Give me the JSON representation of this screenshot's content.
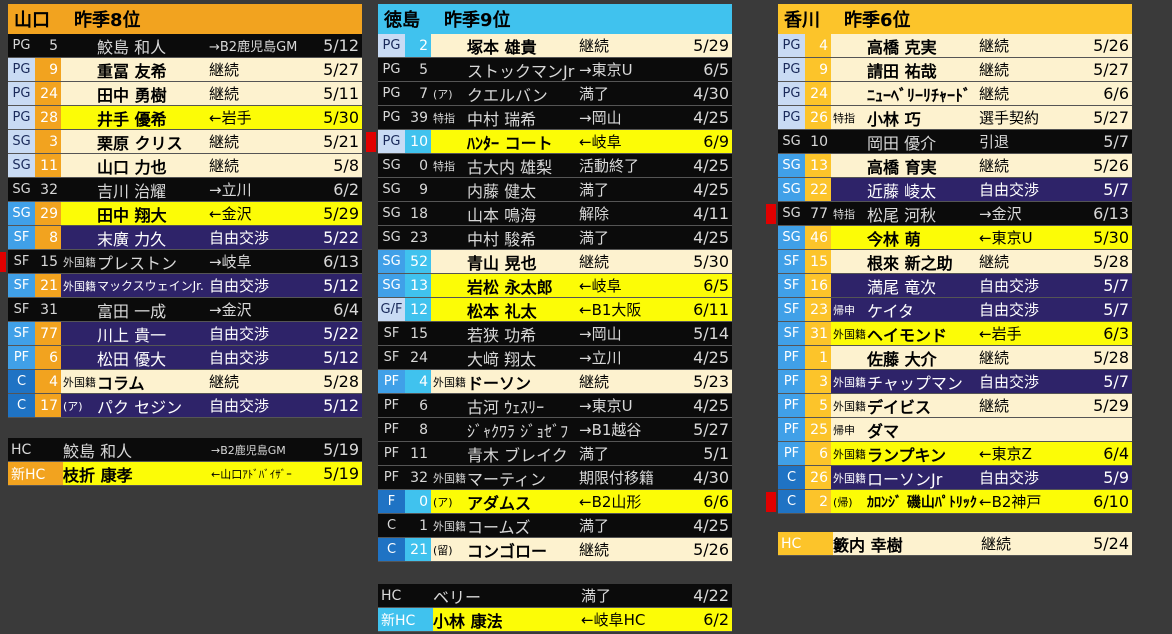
{
  "colors": {
    "black": "#0b0b0b",
    "cream": "#fdf2cf",
    "yellow": "#fcfc06",
    "navy": "#2e2369",
    "orange": "#f2a31f",
    "cyan": "#40c2ee",
    "gold": "#fcc42a",
    "lightblue": "#c9dbf4",
    "blue": "#1f73c4",
    "red": "#e00000",
    "gray": "#555555"
  },
  "panels": [
    {
      "team": "山口",
      "prev": "昨季8位",
      "header_color": "#f2a31f",
      "players": [
        {
          "pos": "PG",
          "num": "5",
          "tag": "",
          "name": "鮫島 和人",
          "status": "→B2鹿児島GM",
          "date": "5/12",
          "theme": "black",
          "pos_color": "#0b0b0b",
          "num_color": "#0b0b0b",
          "mark": false
        },
        {
          "pos": "PG",
          "num": "9",
          "tag": "",
          "name": "重冨 友希",
          "status": "継続",
          "date": "5/27",
          "theme": "cream",
          "pos_color": "#c9dbf4",
          "num_color": "#f2a31f",
          "mark": false
        },
        {
          "pos": "PG",
          "num": "24",
          "tag": "",
          "name": "田中 勇樹",
          "status": "継続",
          "date": "5/11",
          "theme": "cream",
          "pos_color": "#c9dbf4",
          "num_color": "#f2a31f",
          "mark": false
        },
        {
          "pos": "PG",
          "num": "28",
          "tag": "",
          "name": "井手 優希",
          "status": "←岩手",
          "date": "5/30",
          "theme": "yellow",
          "pos_color": "#c9dbf4",
          "num_color": "#f2a31f",
          "mark": false
        },
        {
          "pos": "SG",
          "num": "3",
          "tag": "",
          "name": "栗原 クリス",
          "status": "継続",
          "date": "5/21",
          "theme": "cream",
          "pos_color": "#c9dbf4",
          "num_color": "#f2a31f",
          "mark": false
        },
        {
          "pos": "SG",
          "num": "11",
          "tag": "",
          "name": "山口 力也",
          "status": "継続",
          "date": "5/8",
          "theme": "cream",
          "pos_color": "#c9dbf4",
          "num_color": "#f2a31f",
          "mark": false
        },
        {
          "pos": "SG",
          "num": "32",
          "tag": "",
          "name": "吉川 治耀",
          "status": "→立川",
          "date": "6/2",
          "theme": "black",
          "pos_color": "#0b0b0b",
          "num_color": "#0b0b0b",
          "mark": false
        },
        {
          "pos": "SG",
          "num": "29",
          "tag": "",
          "name": "田中 翔大",
          "status": "←金沢",
          "date": "5/29",
          "theme": "yellow",
          "pos_color": "#40a0e8",
          "num_color": "#f2a31f",
          "mark": false
        },
        {
          "pos": "SF",
          "num": "8",
          "tag": "",
          "name": "末廣 力久",
          "status": "自由交渉",
          "date": "5/22",
          "theme": "navy",
          "pos_color": "#40a0e8",
          "num_color": "#f2a31f",
          "mark": false
        },
        {
          "pos": "SF",
          "num": "15",
          "tag": "外国籍",
          "name": "プレストン",
          "status": "→岐阜",
          "date": "6/13",
          "theme": "black",
          "pos_color": "#0b0b0b",
          "num_color": "#0b0b0b",
          "mark": true
        },
        {
          "pos": "SF",
          "num": "21",
          "tag": "外国籍",
          "name": "マックスウェインJr.",
          "status": "自由交渉",
          "date": "5/12",
          "theme": "navy",
          "pos_color": "#40a0e8",
          "num_color": "#f2a31f",
          "mark": false
        },
        {
          "pos": "SF",
          "num": "31",
          "tag": "",
          "name": "富田 一成",
          "status": "→金沢",
          "date": "6/4",
          "theme": "black",
          "pos_color": "#0b0b0b",
          "num_color": "#0b0b0b",
          "mark": false
        },
        {
          "pos": "SF",
          "num": "77",
          "tag": "",
          "name": "川上 貴一",
          "status": "自由交渉",
          "date": "5/22",
          "theme": "navy",
          "pos_color": "#40a0e8",
          "num_color": "#f2a31f",
          "mark": false
        },
        {
          "pos": "PF",
          "num": "6",
          "tag": "",
          "name": "松田 優大",
          "status": "自由交渉",
          "date": "5/12",
          "theme": "navy",
          "pos_color": "#40a0e8",
          "num_color": "#f2a31f",
          "mark": false
        },
        {
          "pos": "C",
          "num": "4",
          "tag": "外国籍",
          "name": "コラム",
          "status": "継続",
          "date": "5/28",
          "theme": "cream",
          "pos_color": "#1f73c4",
          "num_color": "#f2a31f",
          "mark": false
        },
        {
          "pos": "C",
          "num": "17",
          "tag": "(ア)",
          "name": "パク セジン",
          "status": "自由交渉",
          "date": "5/12",
          "theme": "navy",
          "pos_color": "#1f73c4",
          "num_color": "#f2a31f",
          "mark": false
        }
      ],
      "coaches": [
        {
          "pos": "HC",
          "name": "鮫島 和人",
          "status": "→B2鹿児島GM",
          "date": "5/19",
          "theme": "black",
          "pos_color": "#0b0b0b"
        },
        {
          "pos": "新HC",
          "name": "枝折 康孝",
          "status": "←山口ｱﾄﾞﾊﾞｲｻﾞｰ",
          "date": "5/19",
          "theme": "yellow",
          "pos_color": "#f2a31f"
        }
      ]
    },
    {
      "team": "徳島",
      "prev": "昨季9位",
      "header_color": "#40c2ee",
      "players": [
        {
          "pos": "PG",
          "num": "2",
          "tag": "",
          "name": "塚本 雄貴",
          "status": "継続",
          "date": "5/29",
          "theme": "cream",
          "pos_color": "#c9dbf4",
          "num_color": "#40c2ee",
          "mark": false
        },
        {
          "pos": "PG",
          "num": "5",
          "tag": "",
          "name": "ストックマンJr",
          "status": "→東京U",
          "date": "6/5",
          "theme": "black",
          "pos_color": "#0b0b0b",
          "num_color": "#0b0b0b",
          "mark": false
        },
        {
          "pos": "PG",
          "num": "7",
          "tag": "(ア)",
          "name": "クエルバン",
          "status": "満了",
          "date": "4/30",
          "theme": "black",
          "pos_color": "#0b0b0b",
          "num_color": "#0b0b0b",
          "mark": false
        },
        {
          "pos": "PG",
          "num": "39",
          "tag": "特指",
          "name": "中村 瑞希",
          "status": "→岡山",
          "date": "4/25",
          "theme": "black",
          "pos_color": "#0b0b0b",
          "num_color": "#0b0b0b",
          "mark": false
        },
        {
          "pos": "PG",
          "num": "10",
          "tag": "",
          "name": "ﾊﾝﾀｰ コート",
          "status": "←岐阜",
          "date": "6/9",
          "theme": "yellow",
          "pos_color": "#c9dbf4",
          "num_color": "#40c2ee",
          "mark": true
        },
        {
          "pos": "SG",
          "num": "0",
          "tag": "特指",
          "name": "古大内 雄梨",
          "status": "活動終了",
          "date": "4/25",
          "theme": "black",
          "pos_color": "#0b0b0b",
          "num_color": "#0b0b0b",
          "mark": false
        },
        {
          "pos": "SG",
          "num": "9",
          "tag": "",
          "name": "内藤 健太",
          "status": "満了",
          "date": "4/25",
          "theme": "black",
          "pos_color": "#0b0b0b",
          "num_color": "#0b0b0b",
          "mark": false
        },
        {
          "pos": "SG",
          "num": "18",
          "tag": "",
          "name": "山本 鳴海",
          "status": "解除",
          "date": "4/11",
          "theme": "black",
          "pos_color": "#0b0b0b",
          "num_color": "#0b0b0b",
          "mark": false
        },
        {
          "pos": "SG",
          "num": "23",
          "tag": "",
          "name": "中村 駿希",
          "status": "満了",
          "date": "4/25",
          "theme": "black",
          "pos_color": "#0b0b0b",
          "num_color": "#0b0b0b",
          "mark": false
        },
        {
          "pos": "SG",
          "num": "52",
          "tag": "",
          "name": "青山 晃也",
          "status": "継続",
          "date": "5/30",
          "theme": "cream",
          "pos_color": "#40a0e8",
          "num_color": "#40c2ee",
          "mark": false
        },
        {
          "pos": "SG",
          "num": "13",
          "tag": "",
          "name": "岩松 永太郎",
          "status": "←岐阜",
          "date": "6/5",
          "theme": "yellow",
          "pos_color": "#40a0e8",
          "num_color": "#40c2ee",
          "mark": false
        },
        {
          "pos": "G/F",
          "num": "12",
          "tag": "",
          "name": "松本 礼太",
          "status": "←B1大阪",
          "date": "6/11",
          "theme": "yellow",
          "pos_color": "#c9dbf4",
          "num_color": "#40c2ee",
          "mark": false
        },
        {
          "pos": "SF",
          "num": "15",
          "tag": "",
          "name": "若狭 功希",
          "status": "→岡山",
          "date": "5/14",
          "theme": "black",
          "pos_color": "#0b0b0b",
          "num_color": "#0b0b0b",
          "mark": false
        },
        {
          "pos": "SF",
          "num": "24",
          "tag": "",
          "name": "大﨑 翔太",
          "status": "→立川",
          "date": "4/25",
          "theme": "black",
          "pos_color": "#0b0b0b",
          "num_color": "#0b0b0b",
          "mark": false
        },
        {
          "pos": "PF",
          "num": "4",
          "tag": "外国籍",
          "name": "ドーソン",
          "status": "継続",
          "date": "5/23",
          "theme": "cream",
          "pos_color": "#40a0e8",
          "num_color": "#40c2ee",
          "mark": false
        },
        {
          "pos": "PF",
          "num": "6",
          "tag": "",
          "name": "古河 ｳｪｽﾘｰ",
          "status": "→東京U",
          "date": "4/25",
          "theme": "black",
          "pos_color": "#0b0b0b",
          "num_color": "#0b0b0b",
          "mark": false
        },
        {
          "pos": "PF",
          "num": "8",
          "tag": "",
          "name": "ｼﾞｬｸﾜﾗ ｼﾞｮｾﾞﾌ",
          "status": "→B1越谷",
          "date": "5/27",
          "theme": "black",
          "pos_color": "#0b0b0b",
          "num_color": "#0b0b0b",
          "mark": false
        },
        {
          "pos": "PF",
          "num": "11",
          "tag": "",
          "name": "青木 ブレイク",
          "status": "満了",
          "date": "5/1",
          "theme": "black",
          "pos_color": "#0b0b0b",
          "num_color": "#0b0b0b",
          "mark": false
        },
        {
          "pos": "PF",
          "num": "32",
          "tag": "外国籍",
          "name": "マーティン",
          "status": "期限付移籍",
          "date": "4/30",
          "theme": "black",
          "pos_color": "#0b0b0b",
          "num_color": "#0b0b0b",
          "mark": false
        },
        {
          "pos": "F",
          "num": "0",
          "tag": "(ア)",
          "name": "アダムス",
          "status": "←B2山形",
          "date": "6/6",
          "theme": "yellow",
          "pos_color": "#1f73c4",
          "num_color": "#40c2ee",
          "mark": false
        },
        {
          "pos": "C",
          "num": "1",
          "tag": "外国籍",
          "name": "コームズ",
          "status": "満了",
          "date": "4/25",
          "theme": "black",
          "pos_color": "#0b0b0b",
          "num_color": "#0b0b0b",
          "mark": false
        },
        {
          "pos": "C",
          "num": "21",
          "tag": "(留)",
          "name": "コンゴロー",
          "status": "継続",
          "date": "5/26",
          "theme": "cream",
          "pos_color": "#1f73c4",
          "num_color": "#40c2ee",
          "mark": false
        }
      ],
      "coaches": [
        {
          "pos": "HC",
          "name": "ベリー",
          "status": "満了",
          "date": "4/22",
          "theme": "black",
          "pos_color": "#0b0b0b"
        },
        {
          "pos": "新HC",
          "name": "小林 康法",
          "status": "←岐阜HC",
          "date": "6/2",
          "theme": "yellow",
          "pos_color": "#40c2ee"
        }
      ]
    },
    {
      "team": "香川",
      "prev": "昨季6位",
      "header_color": "#fcc42a",
      "players": [
        {
          "pos": "PG",
          "num": "4",
          "tag": "",
          "name": "高橋 克実",
          "status": "継続",
          "date": "5/26",
          "theme": "cream",
          "pos_color": "#c9dbf4",
          "num_color": "#fcc42a",
          "mark": false
        },
        {
          "pos": "PG",
          "num": "9",
          "tag": "",
          "name": "請田 祐哉",
          "status": "継続",
          "date": "5/27",
          "theme": "cream",
          "pos_color": "#c9dbf4",
          "num_color": "#fcc42a",
          "mark": false
        },
        {
          "pos": "PG",
          "num": "24",
          "tag": "",
          "name": "ﾆｭｰﾍﾞﾘｰﾘﾁｬｰﾄﾞ",
          "status": "継続",
          "date": "6/6",
          "theme": "cream",
          "pos_color": "#c9dbf4",
          "num_color": "#fcc42a",
          "mark": false
        },
        {
          "pos": "PG",
          "num": "26",
          "tag": "特指",
          "name": "小林 巧",
          "status": "選手契約",
          "date": "5/27",
          "theme": "cream",
          "pos_color": "#c9dbf4",
          "num_color": "#fcc42a",
          "mark": false
        },
        {
          "pos": "SG",
          "num": "10",
          "tag": "",
          "name": "岡田 優介",
          "status": "引退",
          "date": "5/7",
          "theme": "black",
          "pos_color": "#0b0b0b",
          "num_color": "#0b0b0b",
          "mark": false
        },
        {
          "pos": "SG",
          "num": "13",
          "tag": "",
          "name": "高橋 育実",
          "status": "継続",
          "date": "5/26",
          "theme": "cream",
          "pos_color": "#40a0e8",
          "num_color": "#fcc42a",
          "mark": false
        },
        {
          "pos": "SG",
          "num": "22",
          "tag": "",
          "name": "近藤 崚太",
          "status": "自由交渉",
          "date": "5/7",
          "theme": "navy",
          "pos_color": "#40a0e8",
          "num_color": "#fcc42a",
          "mark": false
        },
        {
          "pos": "SG",
          "num": "77",
          "tag": "特指",
          "name": "松尾 河秋",
          "status": "→金沢",
          "date": "6/13",
          "theme": "black",
          "pos_color": "#0b0b0b",
          "num_color": "#0b0b0b",
          "mark": true
        },
        {
          "pos": "SG",
          "num": "46",
          "tag": "",
          "name": "今林 萌",
          "status": "←東京U",
          "date": "5/30",
          "theme": "yellow",
          "pos_color": "#40a0e8",
          "num_color": "#fcc42a",
          "mark": false
        },
        {
          "pos": "SF",
          "num": "15",
          "tag": "",
          "name": "根來 新之助",
          "status": "継続",
          "date": "5/28",
          "theme": "cream",
          "pos_color": "#40a0e8",
          "num_color": "#fcc42a",
          "mark": false
        },
        {
          "pos": "SF",
          "num": "16",
          "tag": "",
          "name": "満尾 竜次",
          "status": "自由交渉",
          "date": "5/7",
          "theme": "navy",
          "pos_color": "#40a0e8",
          "num_color": "#fcc42a",
          "mark": false
        },
        {
          "pos": "SF",
          "num": "23",
          "tag": "帰申",
          "name": "ケイタ",
          "status": "自由交渉",
          "date": "5/7",
          "theme": "navy",
          "pos_color": "#40a0e8",
          "num_color": "#fcc42a",
          "mark": false
        },
        {
          "pos": "SF",
          "num": "31",
          "tag": "外国籍",
          "name": "ヘイモンド",
          "status": "←岩手",
          "date": "6/3",
          "theme": "yellow",
          "pos_color": "#40a0e8",
          "num_color": "#fcc42a",
          "mark": false
        },
        {
          "pos": "PF",
          "num": "1",
          "tag": "",
          "name": "佐藤 大介",
          "status": "継続",
          "date": "5/28",
          "theme": "cream",
          "pos_color": "#40a0e8",
          "num_color": "#fcc42a",
          "mark": false
        },
        {
          "pos": "PF",
          "num": "3",
          "tag": "外国籍",
          "name": "チャップマン",
          "status": "自由交渉",
          "date": "5/7",
          "theme": "navy",
          "pos_color": "#40a0e8",
          "num_color": "#fcc42a",
          "mark": false
        },
        {
          "pos": "PF",
          "num": "5",
          "tag": "外国籍",
          "name": "デイビス",
          "status": "継続",
          "date": "5/29",
          "theme": "cream",
          "pos_color": "#40a0e8",
          "num_color": "#fcc42a",
          "mark": false
        },
        {
          "pos": "PF",
          "num": "25",
          "tag": "帰申",
          "name": "ダマ",
          "status": "",
          "date": "",
          "theme": "cream",
          "pos_color": "#40a0e8",
          "num_color": "#fcc42a",
          "mark": false
        },
        {
          "pos": "PF",
          "num": "6",
          "tag": "外国籍",
          "name": "ランプキン",
          "status": "←東京Z",
          "date": "6/4",
          "theme": "yellow",
          "pos_color": "#40a0e8",
          "num_color": "#fcc42a",
          "mark": false
        },
        {
          "pos": "C",
          "num": "26",
          "tag": "外国籍",
          "name": "ローソンJr",
          "status": "自由交渉",
          "date": "5/9",
          "theme": "navy",
          "pos_color": "#1f73c4",
          "num_color": "#fcc42a",
          "mark": false
        },
        {
          "pos": "C",
          "num": "2",
          "tag": "(帰)",
          "name": "ｶﾛﾝｼﾞ 磯山ﾊﾟﾄﾘｯｸ",
          "status": "←B2神戸",
          "date": "6/10",
          "theme": "yellow",
          "pos_color": "#1f73c4",
          "num_color": "#fcc42a",
          "mark": true
        }
      ],
      "coaches": [
        {
          "pos": "HC",
          "name": "籔内 幸樹",
          "status": "継続",
          "date": "5/24",
          "theme": "cream",
          "pos_color": "#fcc42a"
        }
      ]
    }
  ]
}
